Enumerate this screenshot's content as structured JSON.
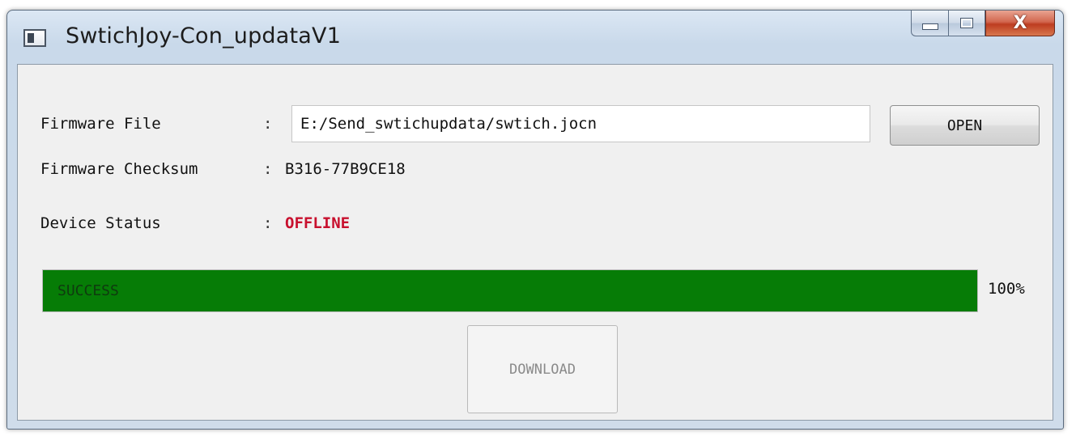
{
  "window": {
    "title": "SwtichJoy-Con_updataV1",
    "icon": "app-window-icon",
    "caption_buttons": {
      "minimize_icon": "minimize-icon",
      "maximize_icon": "maximize-icon",
      "close_glyph": "X"
    }
  },
  "form": {
    "colon": ":",
    "firmware_file": {
      "label": "Firmware File",
      "value": "E:/Send_swtichupdata/swtich.jocn"
    },
    "open_button": {
      "label": "OPEN"
    },
    "firmware_checksum": {
      "label": "Firmware Checksum",
      "value": "B316-77B9CE18"
    },
    "device_status": {
      "label": "Device Status",
      "value": "OFFLINE",
      "value_color": "#c8102e"
    }
  },
  "progress": {
    "text": "SUCCESS",
    "percent_label": "100%",
    "percent": 100,
    "fill_color": "#067c06"
  },
  "download_button": {
    "label": "DOWNLOAD",
    "enabled": false
  }
}
